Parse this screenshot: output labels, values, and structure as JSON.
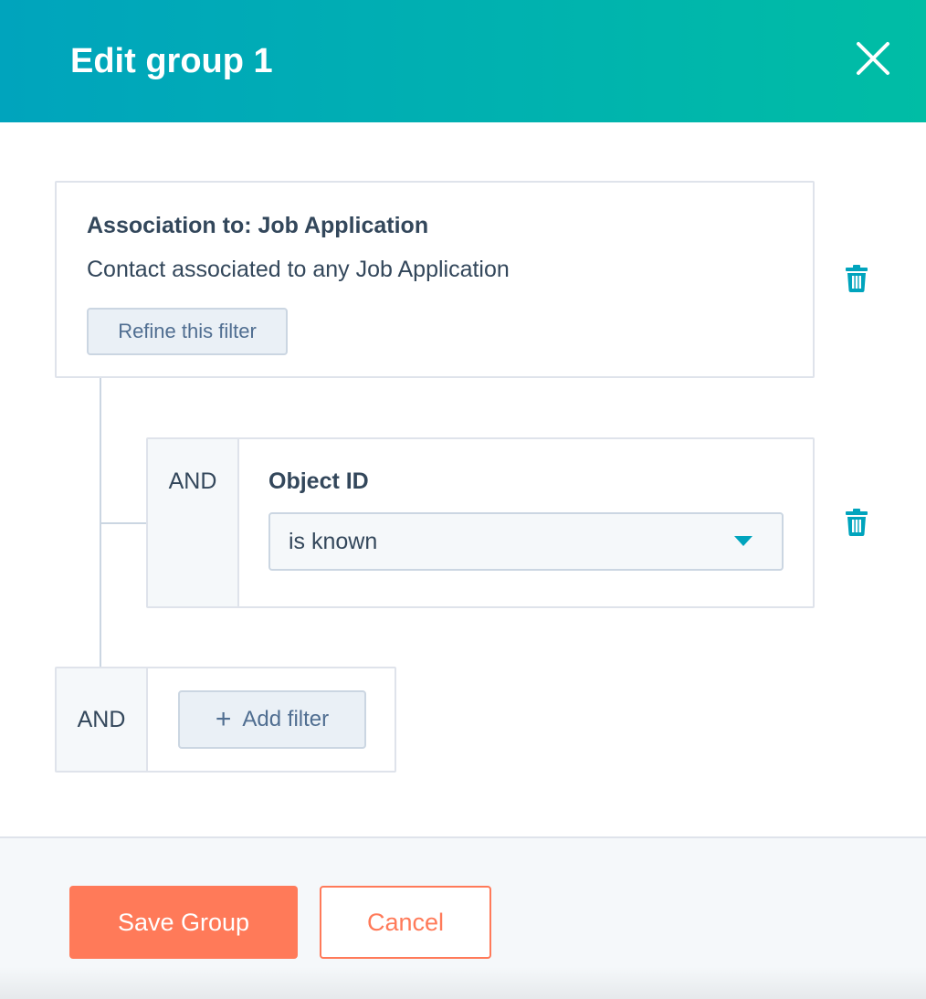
{
  "colors": {
    "header_start": "#00a4bd",
    "header_end": "#00bda5",
    "primary_text": "#33475b",
    "secondary_text": "#506e91",
    "accent_teal": "#00a4bd",
    "action_orange": "#ff7a59",
    "border": "#cbd6e2"
  },
  "header": {
    "title": "Edit group 1",
    "close_icon": "close-icon"
  },
  "filters": [
    {
      "title": "Association to: Job Application",
      "description": "Contact associated to any Job Application",
      "refine_label": "Refine this filter",
      "delete_icon": "trash-icon",
      "sub_filters": [
        {
          "operator": "AND",
          "property": "Object ID",
          "condition": "is known",
          "dropdown_icon": "chevron-down-icon",
          "delete_icon": "trash-icon"
        }
      ]
    }
  ],
  "add_filter": {
    "operator": "AND",
    "label": "Add filter",
    "icon": "plus-icon"
  },
  "footer": {
    "save_label": "Save Group",
    "cancel_label": "Cancel"
  }
}
